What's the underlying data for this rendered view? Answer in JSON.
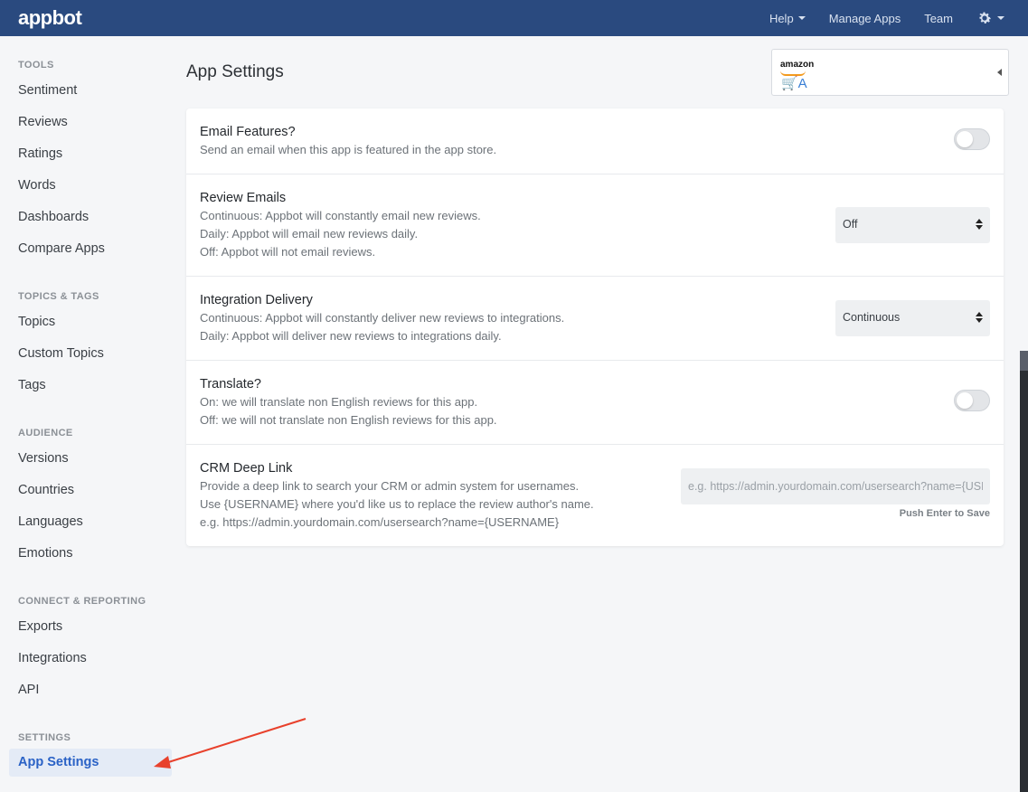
{
  "brand": {
    "logo": "appbot"
  },
  "nav": {
    "help": "Help",
    "manage_apps": "Manage Apps",
    "team": "Team"
  },
  "sidebar": {
    "tools": {
      "heading": "TOOLS",
      "items": [
        "Sentiment",
        "Reviews",
        "Ratings",
        "Words",
        "Dashboards",
        "Compare Apps"
      ]
    },
    "topics": {
      "heading": "TOPICS & TAGS",
      "items": [
        "Topics",
        "Custom Topics",
        "Tags"
      ]
    },
    "audience": {
      "heading": "AUDIENCE",
      "items": [
        "Versions",
        "Countries",
        "Languages",
        "Emotions"
      ]
    },
    "connect": {
      "heading": "CONNECT & REPORTING",
      "items": [
        "Exports",
        "Integrations",
        "API"
      ]
    },
    "settings": {
      "heading": "SETTINGS",
      "items": [
        "App Settings"
      ]
    }
  },
  "main": {
    "title": "App Settings",
    "app_picker": {
      "brand": "amazon",
      "cart": "🛒A"
    },
    "rows": {
      "email_features": {
        "title": "Email Features?",
        "desc": [
          "Send an email when this app is featured in the app store."
        ],
        "toggle_on": false
      },
      "review_emails": {
        "title": "Review Emails",
        "desc": [
          "Continuous: Appbot will constantly email new reviews.",
          "Daily: Appbot will email new reviews daily.",
          "Off: Appbot will not email reviews."
        ],
        "selected": "Off"
      },
      "integration_delivery": {
        "title": "Integration Delivery",
        "desc": [
          "Continuous: Appbot will constantly deliver new reviews to integrations.",
          "Daily: Appbot will deliver new reviews to integrations daily."
        ],
        "selected": "Continuous"
      },
      "translate": {
        "title": "Translate?",
        "desc": [
          "On: we will translate non English reviews for this app.",
          "Off: we will not translate non English reviews for this app."
        ],
        "toggle_on": false
      },
      "crm": {
        "title": "CRM Deep Link",
        "desc": [
          "Provide a deep link to search your CRM or admin system for usernames.",
          "Use {USERNAME} where you'd like us to replace the review author's name.",
          "e.g. https://admin.yourdomain.com/usersearch?name={USERNAME}"
        ],
        "placeholder": "e.g. https://admin.yourdomain.com/usersearch?name={USERNAME}",
        "hint": "Push Enter to Save"
      }
    }
  },
  "colors": {
    "topbar": "#2a4a7f",
    "active_item": "#2a62c6",
    "annotation_arrow": "#e8412c"
  }
}
